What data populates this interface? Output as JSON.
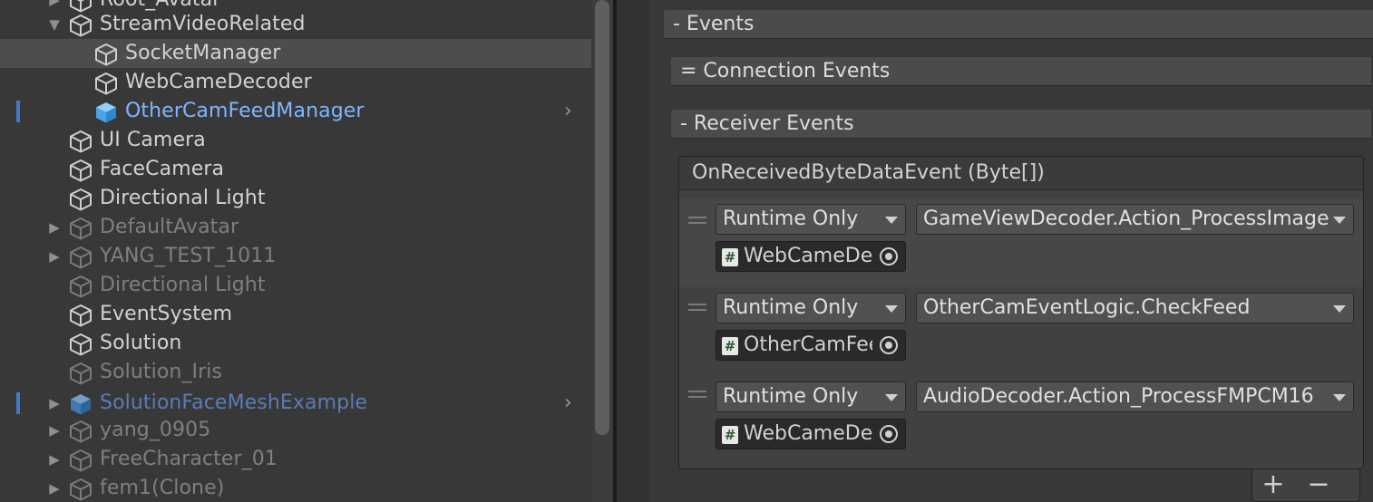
{
  "hierarchy": {
    "rows": [
      {
        "label": "Root_Avatar",
        "arrow": "▶"
      },
      {
        "label": "StreamVideoRelated",
        "arrow": "▼"
      },
      {
        "label": "SocketManager"
      },
      {
        "label": "WebCameDecoder"
      },
      {
        "label": "OtherCamFeedManager",
        "chevron": "›"
      },
      {
        "label": "UI Camera"
      },
      {
        "label": "FaceCamera"
      },
      {
        "label": "Directional Light"
      },
      {
        "label": "DefaultAvatar",
        "arrow": "▶"
      },
      {
        "label": "YANG_TEST_1011",
        "arrow": "▶"
      },
      {
        "label": "Directional Light"
      },
      {
        "label": "EventSystem"
      },
      {
        "label": "Solution"
      },
      {
        "label": "Solution_Iris"
      },
      {
        "label": "SolutionFaceMeshExample",
        "arrow": "▶",
        "chevron": "›"
      },
      {
        "label": "yang_0905",
        "arrow": "▶"
      },
      {
        "label": "FreeCharacter_01",
        "arrow": "▶"
      },
      {
        "label": "fem1(Clone)",
        "arrow": "▶"
      }
    ]
  },
  "inspector": {
    "events_foldout": "- Events",
    "connection_events": "= Connection Events",
    "receiver_events": "- Receiver Events",
    "event_box": {
      "title": "OnReceivedByteDataEvent (Byte[])",
      "entries": [
        {
          "mode": "Runtime Only",
          "function": "GameViewDecoder.Action_ProcessImageData",
          "target": "WebCameDecoder"
        },
        {
          "mode": "Runtime Only",
          "function": "OtherCamEventLogic.CheckFeed",
          "target": "OtherCamFeedManager"
        },
        {
          "mode": "Runtime Only",
          "function": "AudioDecoder.Action_ProcessFMPCM16",
          "target": "WebCameDecoder"
        }
      ]
    },
    "add_button": "+",
    "remove_button": "−"
  },
  "colors": {
    "background": "#383838",
    "selected_row": "#4d4d4d",
    "prefab_text": "#7fb5ff",
    "prefab_mark": "#3f79c7"
  },
  "icons": {
    "gameobject": "cube-icon",
    "prefab": "prefab-cube-icon",
    "script": "script-hash-icon",
    "object_picker": "object-picker-icon"
  }
}
